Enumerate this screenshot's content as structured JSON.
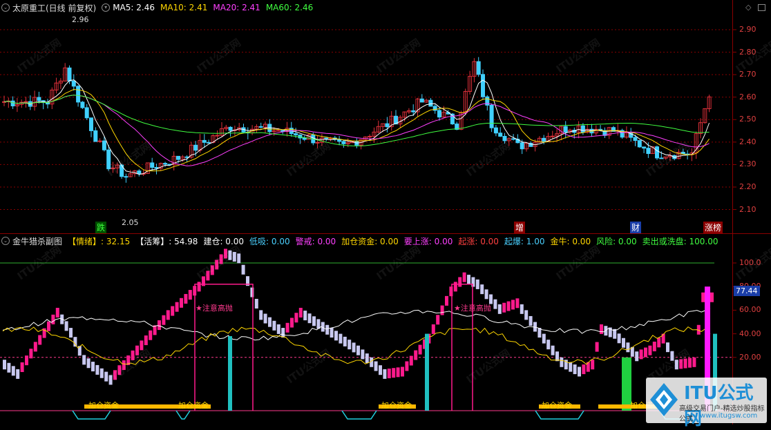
{
  "top": {
    "title": "太原重工(日线 前复权)",
    "ma": [
      {
        "label": "MA5: 2.46",
        "color": "#ffffff"
      },
      {
        "label": "MA10: 2.41",
        "color": "#ffd700"
      },
      {
        "label": "MA20: 2.41",
        "color": "#ff40ff"
      },
      {
        "label": "MA60: 2.46",
        "color": "#40ff40"
      }
    ],
    "y_ticks": [
      "2.90",
      "2.80",
      "2.70",
      "2.60",
      "2.50",
      "2.40",
      "2.30",
      "2.20",
      "2.10"
    ],
    "high_marker": "2.96",
    "low_marker": "2.05",
    "events": [
      {
        "label": "跌",
        "color": "#40ff40",
        "bg": "#005000"
      },
      {
        "label": "增",
        "color": "#ffffff",
        "bg": "#8b0000"
      },
      {
        "label": "财",
        "color": "#ffffff",
        "bg": "#1a3ea8"
      },
      {
        "label": "涨榜",
        "color": "#ffffff",
        "bg": "#8b0000"
      }
    ]
  },
  "bottom": {
    "title": "金牛猎杀副图",
    "values": [
      {
        "label": "【情绪】: 32.15",
        "color": "#ffd700"
      },
      {
        "label": "【活筹】: 54.98",
        "color": "#ffffff"
      },
      {
        "label": "建仓: 0.00",
        "color": "#ffffff"
      },
      {
        "label": "低吸: 0.00",
        "color": "#4ad0ff"
      },
      {
        "label": "警戒: 0.00",
        "color": "#ff40ff"
      },
      {
        "label": "加仓资金: 0.00",
        "color": "#ffd700"
      },
      {
        "label": "要上涨: 0.00",
        "color": "#ff40ff"
      },
      {
        "label": "起涨: 0.00",
        "color": "#ff4040"
      },
      {
        "label": "起爆: 1.00",
        "color": "#4ad0ff"
      },
      {
        "label": "金牛: 0.00",
        "color": "#ffd700"
      },
      {
        "label": "风险: 0.00",
        "color": "#40ff40"
      },
      {
        "label": "卖出或洗盘: 100.00",
        "color": "#40ff40"
      }
    ],
    "y_ticks": [
      "100.0",
      "80.00",
      "60.00",
      "40.00",
      "20.00"
    ],
    "current_value": "77.44",
    "annotations": [
      "★注意高抛",
      "★注意高抛"
    ],
    "fund_labels": [
      "加仓资金",
      "加仓资金",
      "加仓资金",
      "加仓资金",
      "加仓资金"
    ]
  },
  "watermark": {
    "text": "ITU公式网",
    "url": "www.itugsw.com",
    "tagline": "高级交易门户-精选炒股指标公式"
  },
  "colors": {
    "up": "#e0303a",
    "down": "#40d0ff",
    "bg": "#000000",
    "grid": "#8b0000"
  }
}
